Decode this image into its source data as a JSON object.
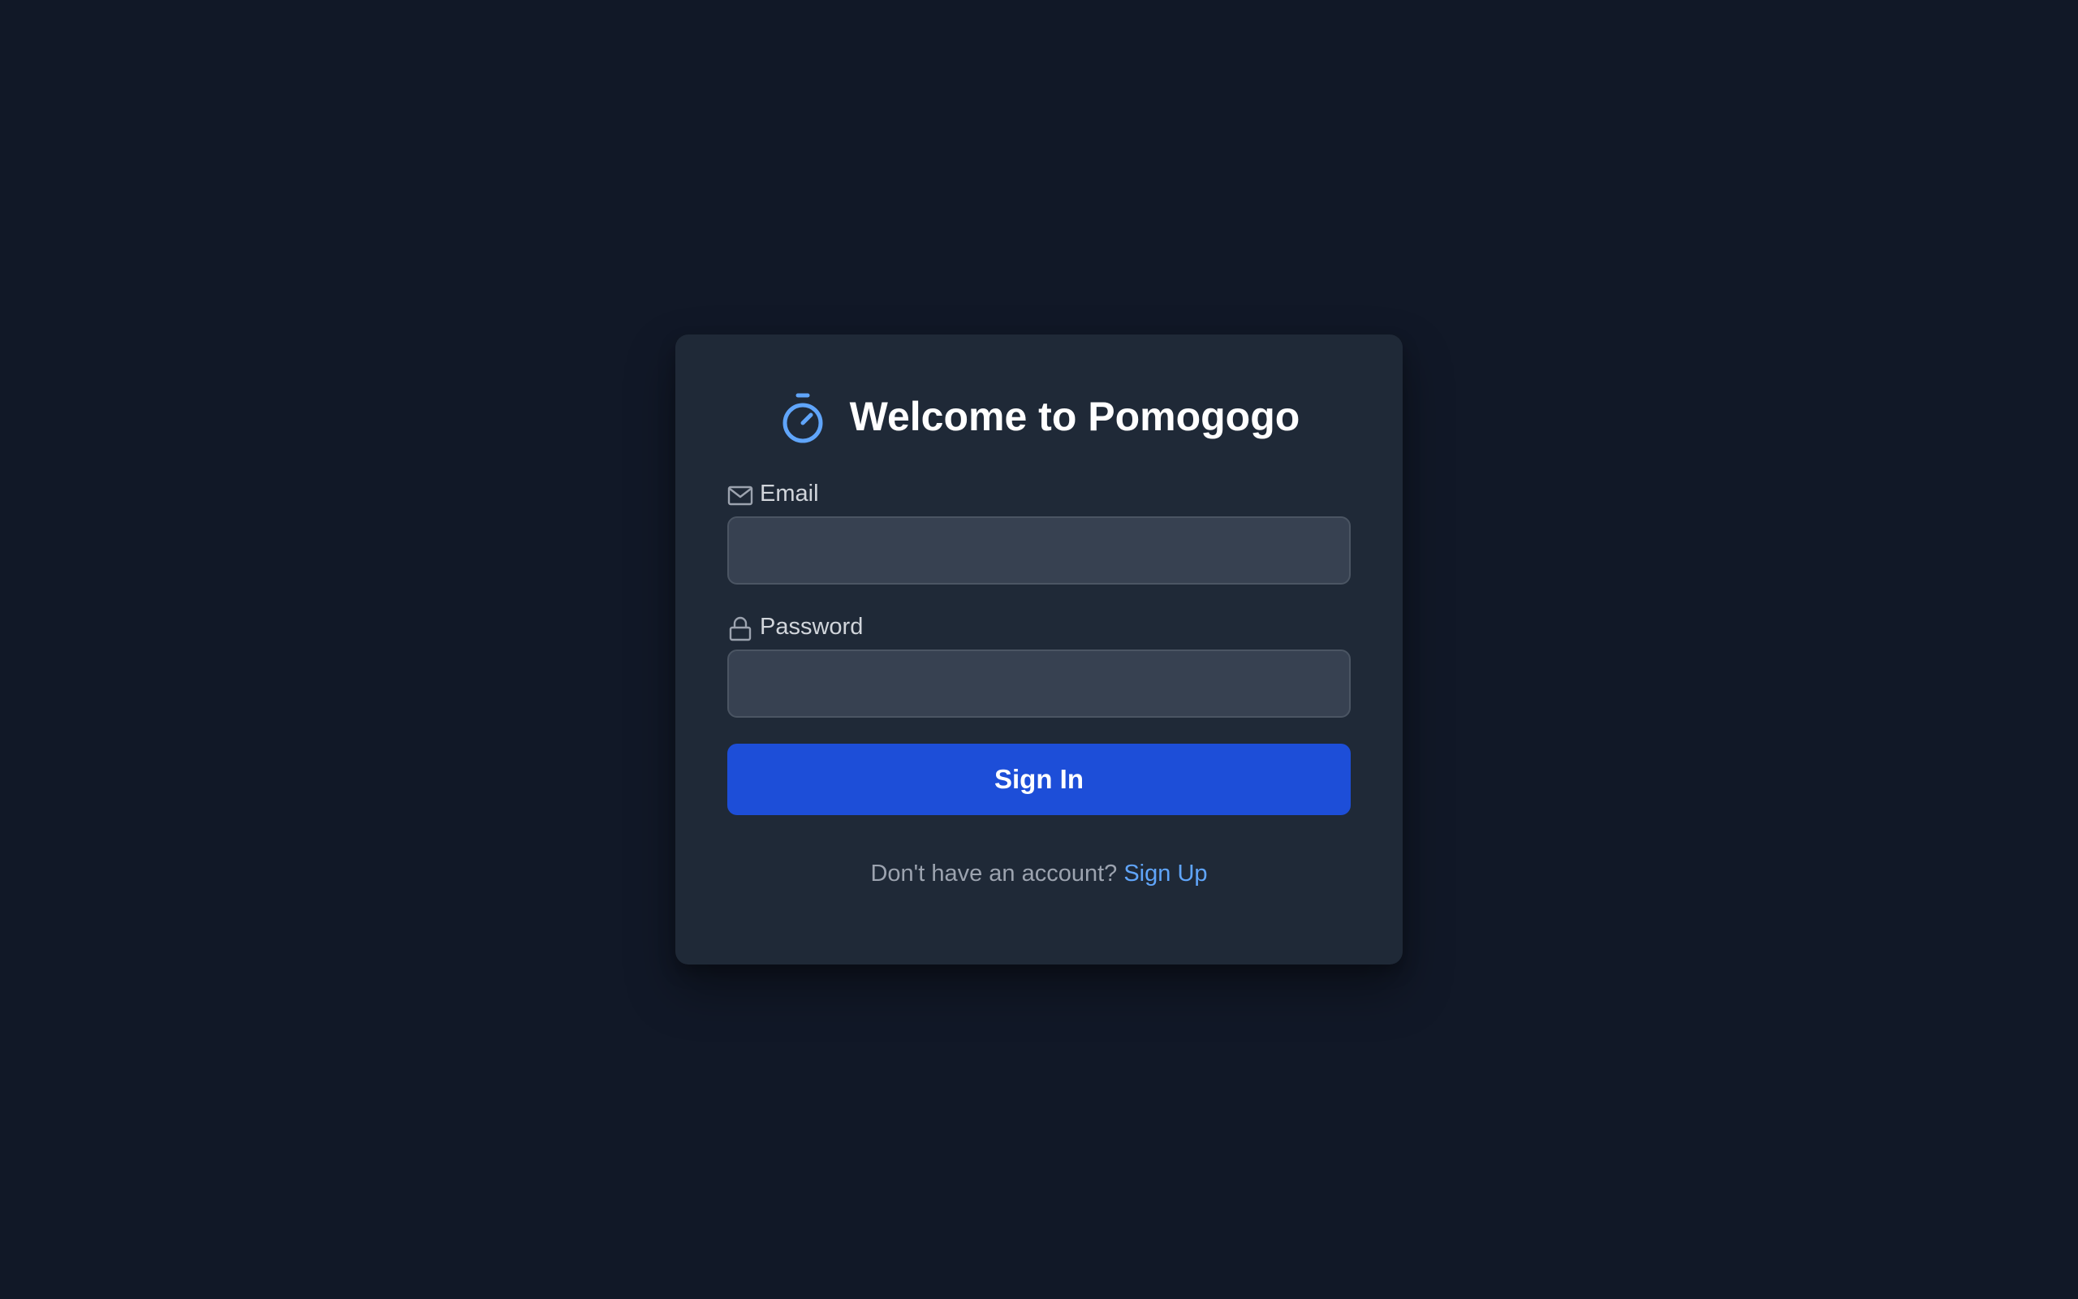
{
  "login": {
    "title": "Welcome to Pomogogo",
    "logo_icon": "stopwatch-icon",
    "email": {
      "icon": "mail-icon",
      "label": "Email",
      "value": "",
      "placeholder": ""
    },
    "password": {
      "icon": "lock-icon",
      "label": "Password",
      "value": "",
      "placeholder": ""
    },
    "submit_label": "Sign In",
    "footer": {
      "prompt": "Don't have an account? ",
      "link": "Sign Up"
    }
  },
  "colors": {
    "page_background": "#111827",
    "card_background": "#1f2937",
    "input_background": "#374151",
    "accent": "#1d4ed8",
    "link": "#60a5fa",
    "logo": "#60a5fa"
  }
}
